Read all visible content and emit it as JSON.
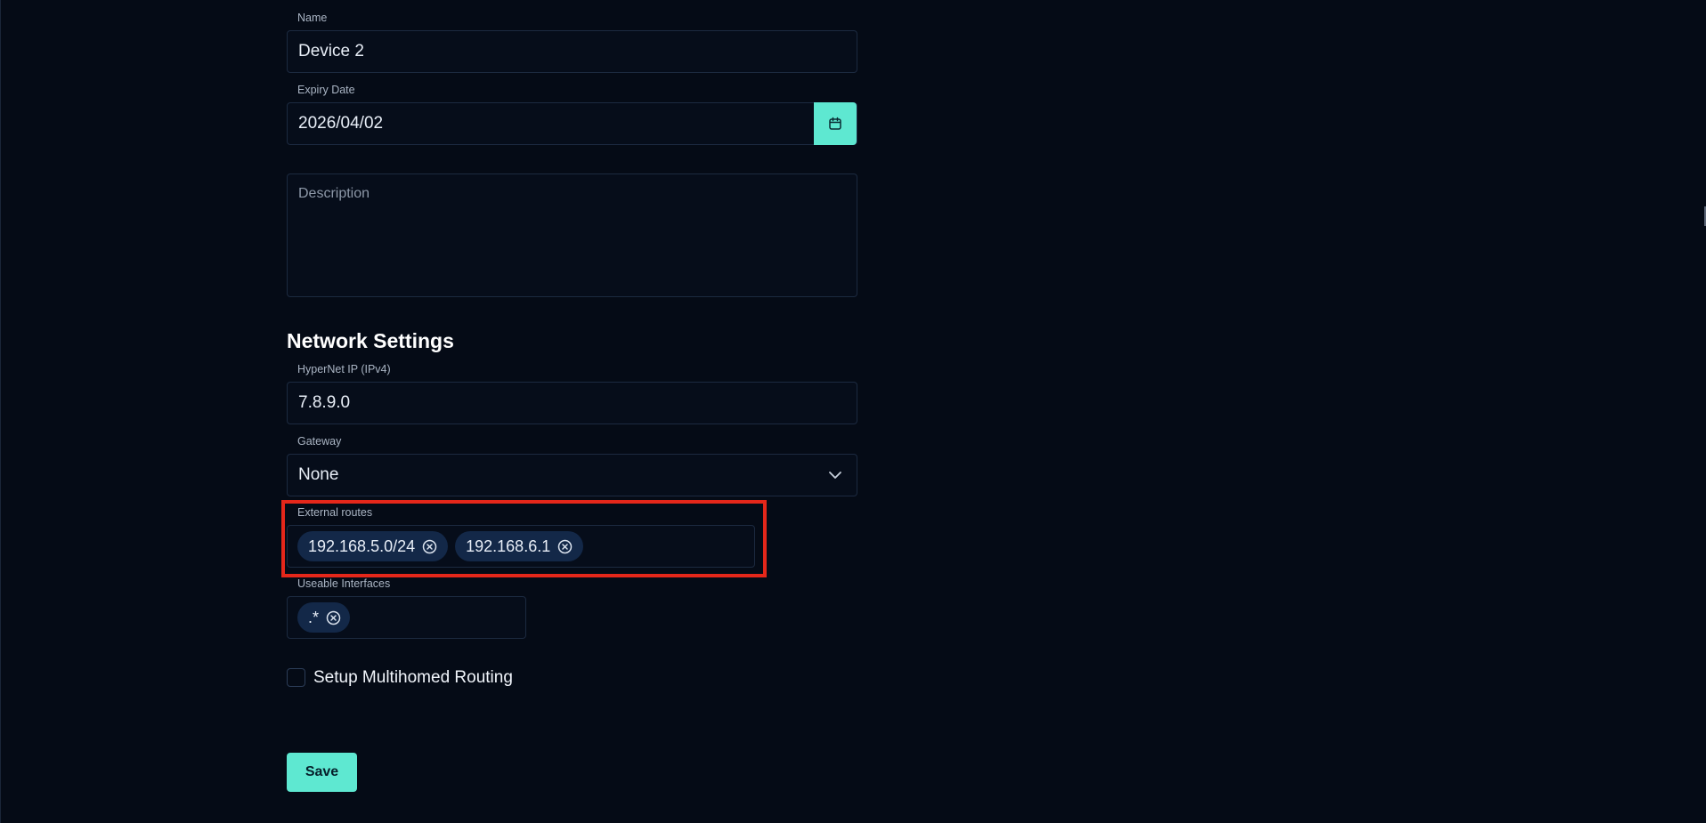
{
  "form": {
    "name": {
      "label": "Name",
      "value": "Device 2"
    },
    "expiry": {
      "label": "Expiry Date",
      "value": "2026/04/02",
      "icon": "calendar-icon"
    },
    "description": {
      "placeholder": "Description"
    }
  },
  "network": {
    "title": "Network Settings",
    "hypernet_ip": {
      "label": "HyperNet IP (IPv4)",
      "value": "7.8.9.0"
    },
    "gateway": {
      "label": "Gateway",
      "value": "None",
      "icon": "chevron-down-icon"
    },
    "external_routes": {
      "label": "External routes",
      "chips": [
        "192.168.5.0/24",
        "192.168.6.1"
      ]
    },
    "useable_interfaces": {
      "label": "Useable Interfaces",
      "chips": [
        ".*"
      ]
    },
    "multihomed": {
      "label": "Setup Multihomed Routing",
      "checked": false
    }
  },
  "actions": {
    "save_label": "Save"
  },
  "colors": {
    "accent": "#5ee8d1",
    "background": "#050b16",
    "chip": "#132848",
    "highlight": "#e5271a"
  }
}
